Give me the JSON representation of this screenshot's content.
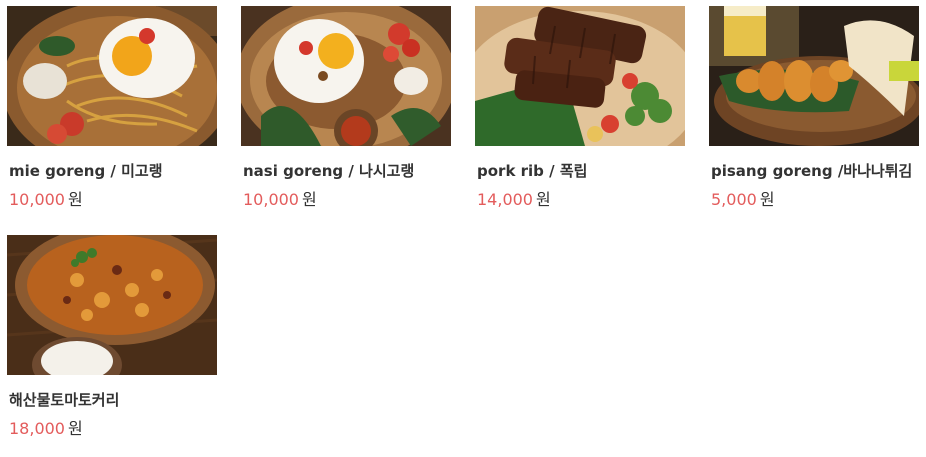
{
  "colors": {
    "price": "#e35c5c",
    "name": "#333333",
    "background": "#ffffff"
  },
  "products": [
    {
      "name": "mie goreng / 미고랭",
      "price": "10,000",
      "unit": "원",
      "image": "fried-noodles-with-egg-photo"
    },
    {
      "name": "nasi goreng / 나시고랭",
      "price": "10,000",
      "unit": "원",
      "image": "fried-rice-with-egg-photo"
    },
    {
      "name": "pork rib / 폭립",
      "price": "14,000",
      "unit": "원",
      "image": "pork-ribs-photo"
    },
    {
      "name": "pisang goreng /바나나튀김",
      "price": "5,000",
      "unit": "원",
      "image": "banana-fritters-photo"
    },
    {
      "name": "해산물토마토커리",
      "price": "18,000",
      "unit": "원",
      "image": "seafood-tomato-curry-photo"
    }
  ]
}
